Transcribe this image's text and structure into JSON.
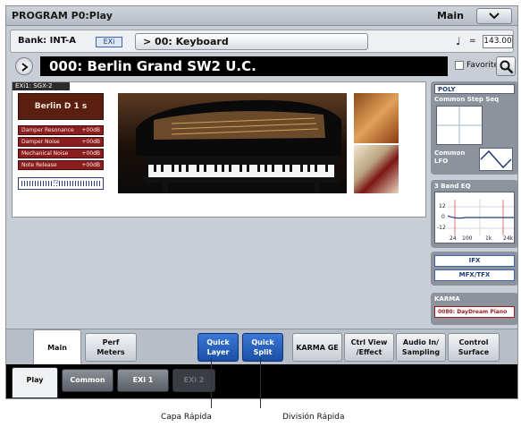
{
  "window": {
    "title": "PROGRAM P0:Play",
    "mode": "Main"
  },
  "bank": {
    "label": "Bank: INT-A",
    "badge": "EXi",
    "program_button": "> 00: Keyboard"
  },
  "tempo": {
    "note_symbol": "♩",
    "eq": "=",
    "value": "143.00"
  },
  "program": {
    "name": "000: Berlin Grand SW2 U.C.",
    "favorite_label": "Favorite"
  },
  "exi": {
    "tag": "EXi1: SGX-2",
    "engine_name": "Berlin D 1 s",
    "params": [
      {
        "label": "Damper Resonance",
        "value": "+00dB"
      },
      {
        "label": "Damper Noise",
        "value": "+00dB"
      },
      {
        "label": "Mechanical Noise",
        "value": "+00dB"
      },
      {
        "label": "Note Release",
        "value": "+00dB"
      }
    ],
    "velocity_value": "72"
  },
  "side": {
    "poly": "POLY",
    "common_step_seq": "Common Step Seq",
    "common_lfo": "Common LFO",
    "eq_title": "3 Band EQ",
    "eq_labels": {
      "y_top": "12",
      "y_mid": "0",
      "y_bottom": "-12",
      "x1": "24",
      "x2": "100",
      "x3": "1k",
      "x4": "24k"
    },
    "ifx": "IFX",
    "mfx": "MFX/TFX",
    "karma_title": "KARMA",
    "karma_value": "0080: DayDream Piano"
  },
  "tabs": [
    {
      "label": "Main"
    },
    {
      "label": "Perf\nMeters"
    },
    {
      "label": "Quick\nLayer"
    },
    {
      "label": "Quick\nSplit"
    },
    {
      "label": "KARMA GE"
    },
    {
      "label": "Ctrl View\n/Effect"
    },
    {
      "label": "Audio In/\nSampling"
    },
    {
      "label": "Control\nSurface"
    }
  ],
  "bottom_tabs": [
    {
      "label": "Play"
    },
    {
      "label": "Common"
    },
    {
      "label": "EXi 1"
    },
    {
      "label": "EXi 2"
    }
  ],
  "callouts": {
    "left": "Capa Rápida",
    "right": "División Rápida"
  }
}
